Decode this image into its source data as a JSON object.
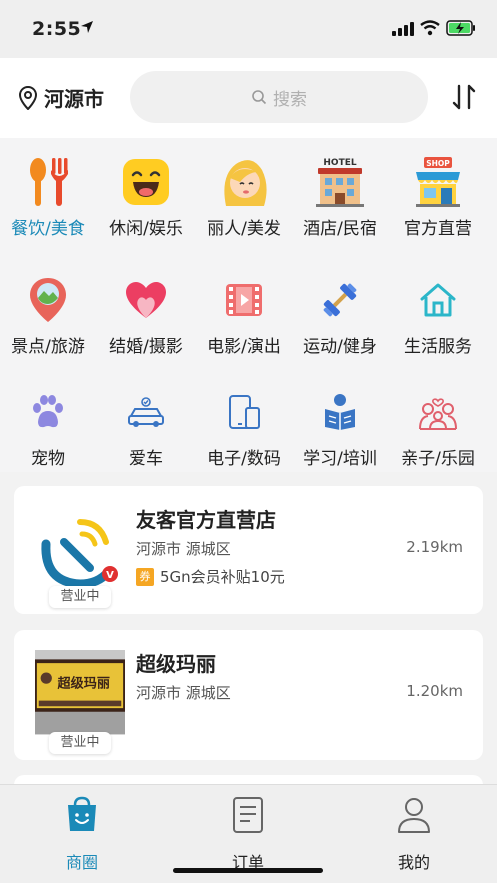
{
  "status": {
    "time": "2:55"
  },
  "header": {
    "city": "河源市",
    "search_placeholder": "搜索"
  },
  "categories": [
    {
      "label": "餐饮/美食",
      "icon": "utensils-icon",
      "active": true
    },
    {
      "label": "休闲/娱乐",
      "icon": "laughing-face-icon"
    },
    {
      "label": "丽人/美发",
      "icon": "woman-face-icon"
    },
    {
      "label": "酒店/民宿",
      "icon": "hotel-icon",
      "badge": "HOTEL"
    },
    {
      "label": "官方直营",
      "icon": "shop-icon",
      "badge": "SHOP"
    },
    {
      "label": "景点/旅游",
      "icon": "map-pin-icon"
    },
    {
      "label": "结婚/摄影",
      "icon": "heart-icon"
    },
    {
      "label": "电影/演出",
      "icon": "film-icon"
    },
    {
      "label": "运动/健身",
      "icon": "dumbbell-icon"
    },
    {
      "label": "生活服务",
      "icon": "house-icon"
    },
    {
      "label": "宠物",
      "icon": "paw-icon"
    },
    {
      "label": "爱车",
      "icon": "car-icon"
    },
    {
      "label": "电子/数码",
      "icon": "devices-icon"
    },
    {
      "label": "学习/培训",
      "icon": "reading-icon"
    },
    {
      "label": "亲子/乐园",
      "icon": "family-icon"
    }
  ],
  "stores": [
    {
      "name": "友客官方直营店",
      "area": "河源市 源城区",
      "distance": "2.19km",
      "status": "营业中",
      "promo_tag": "券",
      "promo": "5Gn会员补贴10元"
    },
    {
      "name": "超级玛丽",
      "area": "河源市 源城区",
      "distance": "1.20km",
      "status": "营业中",
      "thumb_text": "超级玛丽"
    }
  ],
  "tabs": [
    {
      "label": "商圈",
      "icon": "shopping-bag-icon",
      "active": true
    },
    {
      "label": "订单",
      "icon": "order-list-icon"
    },
    {
      "label": "我的",
      "icon": "user-icon"
    }
  ],
  "colors": {
    "accent": "#1b8ab8"
  }
}
